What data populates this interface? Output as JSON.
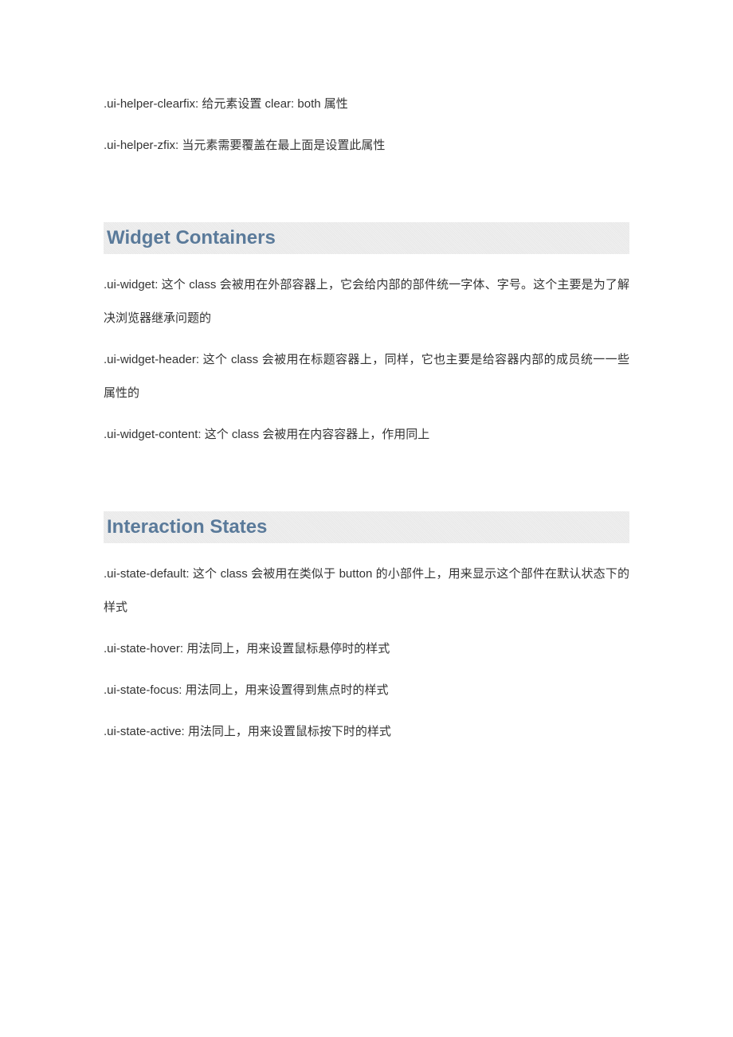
{
  "intro": {
    "p1": ".ui-helper-clearfix: 给元素设置 clear: both 属性",
    "p2": ".ui-helper-zfix: 当元素需要覆盖在最上面是设置此属性"
  },
  "section1": {
    "heading": "Widget Containers",
    "p1": ".ui-widget: 这个 class 会被用在外部容器上，它会给内部的部件统一字体、字号。这个主要是为了解决浏览器继承问题的",
    "p2": ".ui-widget-header: 这个 class 会被用在标题容器上，同样，它也主要是给容器内部的成员统一一些属性的",
    "p3": ".ui-widget-content: 这个 class 会被用在内容容器上，作用同上"
  },
  "section2": {
    "heading": "Interaction States",
    "p1": ".ui-state-default: 这个 class 会被用在类似于 button 的小部件上，用来显示这个部件在默认状态下的样式",
    "p2": ".ui-state-hover: 用法同上，用来设置鼠标悬停时的样式",
    "p3": ".ui-state-focus: 用法同上，用来设置得到焦点时的样式",
    "p4": ".ui-state-active: 用法同上，用来设置鼠标按下时的样式"
  }
}
